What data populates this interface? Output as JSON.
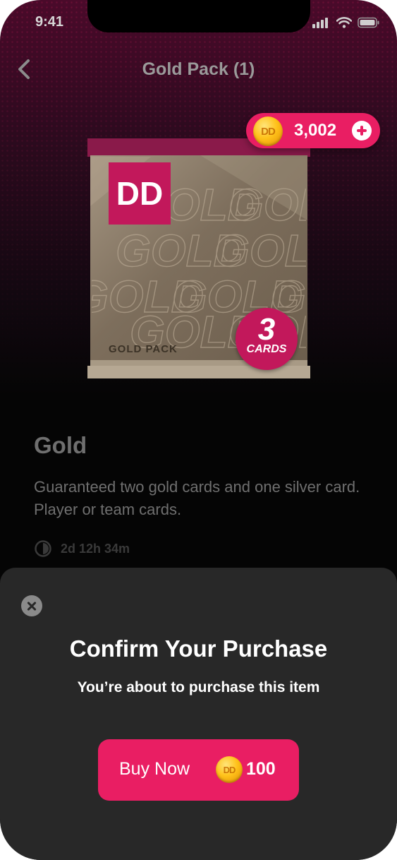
{
  "status_bar": {
    "time": "9:41"
  },
  "header": {
    "title": "Gold Pack (1)"
  },
  "balance": {
    "coin_label": "DD",
    "amount": "3,002"
  },
  "pack": {
    "logo_text": "DD",
    "pattern_word": "GOLD",
    "label": "GOLD PACK",
    "card_count": "3",
    "cards_label": "CARDS"
  },
  "item": {
    "name": "Gold",
    "description": "Guaranteed two gold cards and one silver card. Player or team cards.",
    "time_remaining": "2d 12h 34m"
  },
  "dialog": {
    "title": "Confirm Your Purchase",
    "subtitle": "You’re about to purchase this item",
    "buy_label": "Buy Now",
    "coin_label": "DD",
    "price": "100"
  },
  "colors": {
    "accent": "#e91e63",
    "sheet_bg": "#282828",
    "coin": "#ffc21a"
  }
}
